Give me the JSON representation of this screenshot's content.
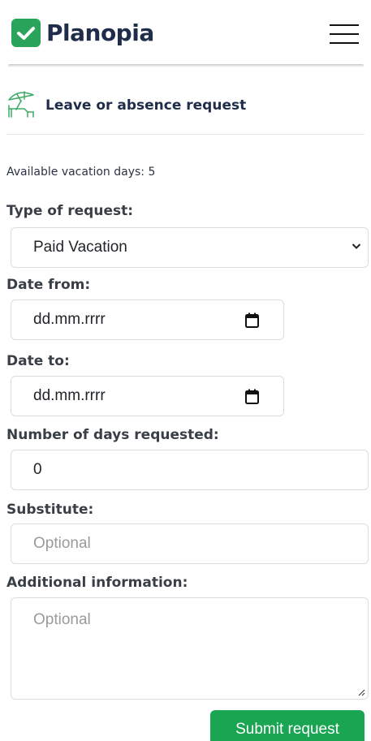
{
  "brand": {
    "name": "Planopia"
  },
  "section": {
    "title": "Leave or absence request"
  },
  "form": {
    "available_days_text": "Available vacation days: 5",
    "type_label": "Type of request:",
    "type_value": "Paid Vacation",
    "date_from_label": "Date from:",
    "date_from_placeholder": "dd.mm.rrrr",
    "date_to_label": "Date to:",
    "date_to_placeholder": "dd.mm.rrrr",
    "days_label": "Number of days requested:",
    "days_value": "0",
    "substitute_label": "Substitute:",
    "substitute_placeholder": "Optional",
    "info_label": "Additional information:",
    "info_placeholder": "Optional",
    "submit_label": "Submit request"
  },
  "colors": {
    "brand_green": "#2aa45a",
    "submit_green": "#1aa553",
    "brand_text": "#1f2d4a"
  },
  "icons": {
    "logo": "check-icon",
    "menu": "hamburger-icon",
    "section": "beach-umbrella-icon",
    "select": "chevron-down-icon",
    "date": "calendar-icon"
  }
}
